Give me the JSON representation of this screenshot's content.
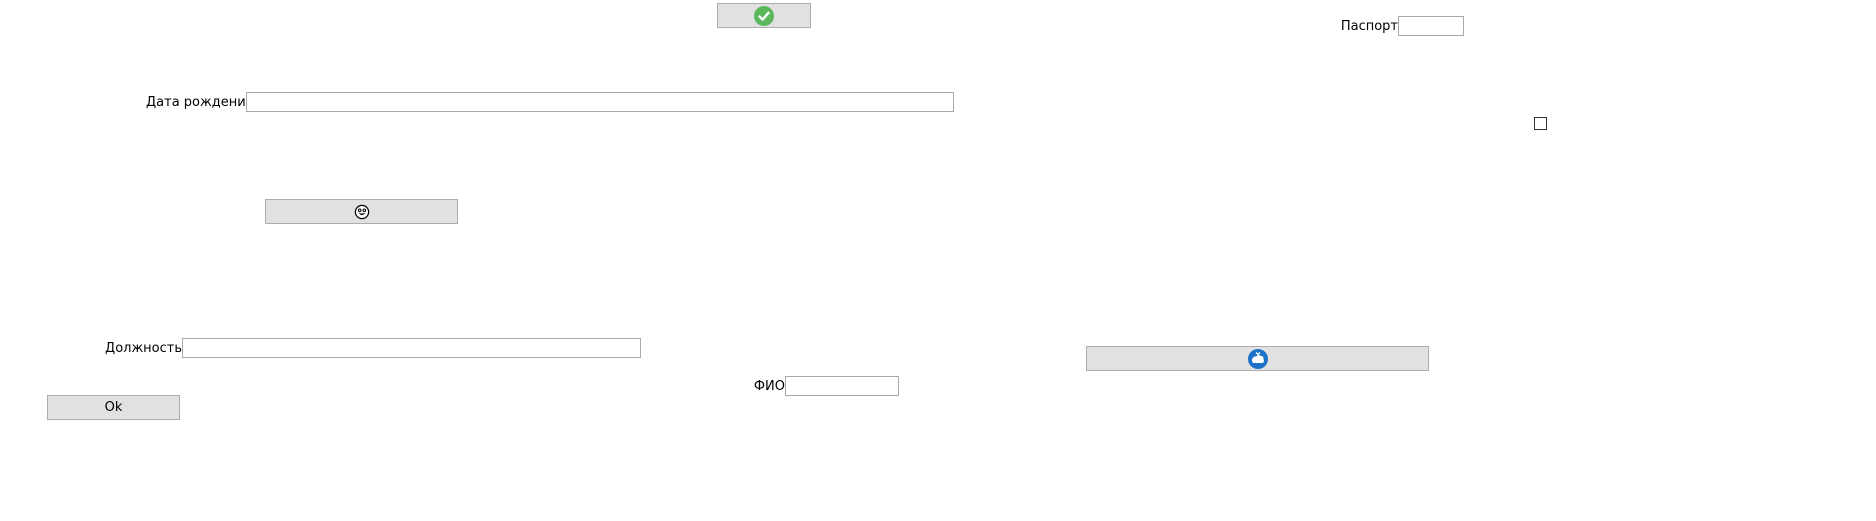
{
  "buttons": {
    "confirm": {
      "icon": "green-checkmark-icon",
      "label": ""
    },
    "emoji": {
      "icon": "face-emoji-icon",
      "label": ""
    },
    "globe": {
      "icon": "blue-globe-icon",
      "label": ""
    },
    "ok": {
      "label": "Ok"
    }
  },
  "fields": {
    "passport": {
      "label": "Паспорт",
      "value": ""
    },
    "birth_date": {
      "label": "Дата рождения",
      "value": ""
    },
    "position": {
      "label": "Должность",
      "value": ""
    },
    "full_name": {
      "label": "ФИО",
      "value": ""
    }
  },
  "checkbox": {
    "checked": false
  },
  "colors": {
    "button_bg": "#e1e1e1",
    "button_border": "#adadad",
    "field_border": "#a9a9a9",
    "check_green": "#5cb85c",
    "globe_blue": "#1b72c8"
  }
}
